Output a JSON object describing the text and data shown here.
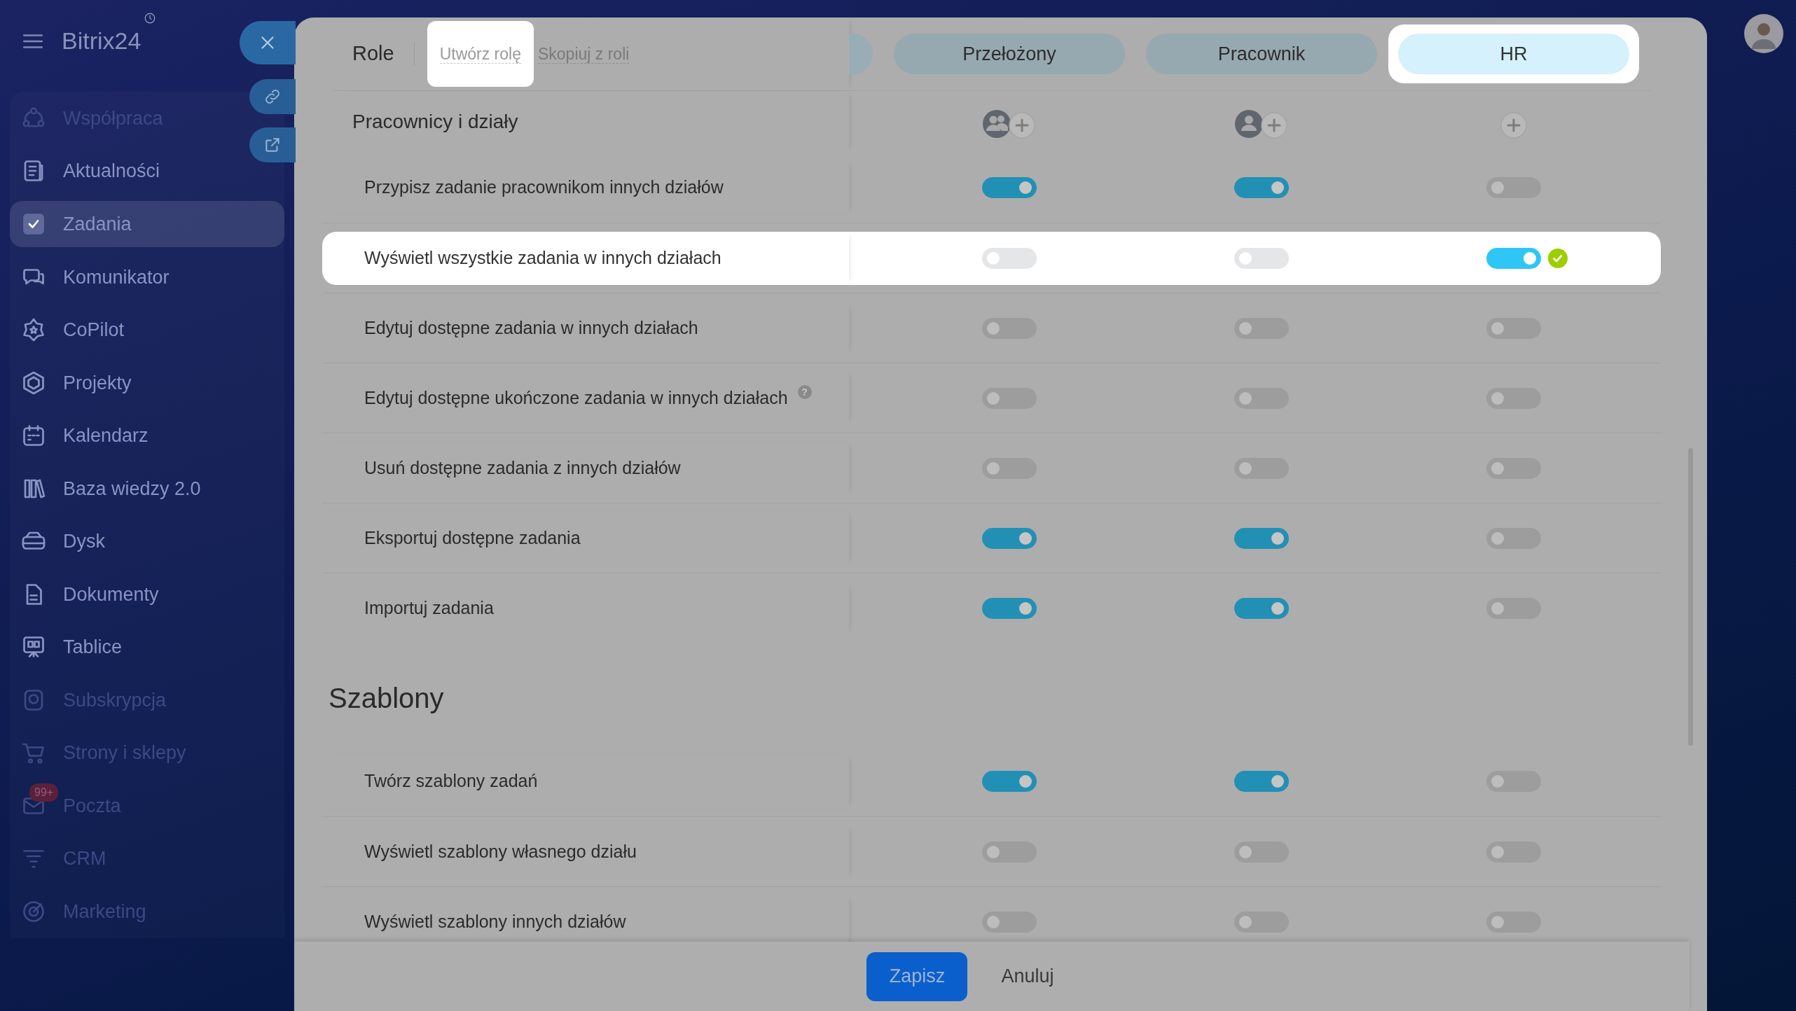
{
  "sidebar": {
    "logo": "Bitrix24",
    "items": [
      {
        "label": "Współpraca",
        "selected": false,
        "dimmed": true
      },
      {
        "label": "Aktualności",
        "selected": false,
        "dimmed": false
      },
      {
        "label": "Zadania",
        "selected": true,
        "dimmed": false
      },
      {
        "label": "Komunikator",
        "selected": false,
        "dimmed": false
      },
      {
        "label": "CoPilot",
        "selected": false,
        "dimmed": false
      },
      {
        "label": "Projekty",
        "selected": false,
        "dimmed": false
      },
      {
        "label": "Kalendarz",
        "selected": false,
        "dimmed": false
      },
      {
        "label": "Baza wiedzy 2.0",
        "selected": false,
        "dimmed": false
      },
      {
        "label": "Dysk",
        "selected": false,
        "dimmed": false
      },
      {
        "label": "Dokumenty",
        "selected": false,
        "dimmed": false
      },
      {
        "label": "Tablice",
        "selected": false,
        "dimmed": false
      },
      {
        "label": "Subskrypcja",
        "selected": false,
        "dimmed": true
      },
      {
        "label": "Strony i sklepy",
        "selected": false,
        "dimmed": true
      },
      {
        "label": "Poczta",
        "selected": false,
        "dimmed": true,
        "badge": "99+"
      },
      {
        "label": "CRM",
        "selected": false,
        "dimmed": true
      },
      {
        "label": "Marketing",
        "selected": false,
        "dimmed": true
      }
    ]
  },
  "header": {
    "title": "Role",
    "actions": [
      {
        "label": "Utwórz rolę",
        "highlighted": true
      },
      {
        "label": "Skopiuj z roli",
        "highlighted": false
      }
    ]
  },
  "roles": [
    {
      "label": "Przełożony",
      "highlighted": false,
      "members": {
        "kind": "group"
      }
    },
    {
      "label": "Pracownik",
      "highlighted": false,
      "members": {
        "kind": "single"
      }
    },
    {
      "label": "HR",
      "highlighted": true,
      "members": {
        "kind": "add_only"
      }
    }
  ],
  "sections": [
    {
      "title": "Pracownicy i działy",
      "kind": "row_heading",
      "rows": [
        {
          "label": "Przypisz zadanie pracownikom innych działów",
          "highlighted": false,
          "values": [
            {
              "on": true
            },
            {
              "on": true
            },
            {
              "on": false
            }
          ]
        },
        {
          "label": "Wyświetl wszystkie zadania w innych działach",
          "highlighted": true,
          "values": [
            {
              "on": false
            },
            {
              "on": false
            },
            {
              "on": true,
              "confirmed": true
            }
          ]
        },
        {
          "label": "Edytuj dostępne zadania w innych działach",
          "highlighted": false,
          "values": [
            {
              "on": false
            },
            {
              "on": false
            },
            {
              "on": false
            }
          ]
        },
        {
          "label": "Edytuj dostępne ukończone zadania w innych działach",
          "help": "?",
          "highlighted": false,
          "values": [
            {
              "on": false
            },
            {
              "on": false
            },
            {
              "on": false
            }
          ]
        },
        {
          "label": "Usuń dostępne zadania z innych działów",
          "highlighted": false,
          "values": [
            {
              "on": false
            },
            {
              "on": false
            },
            {
              "on": false
            }
          ]
        },
        {
          "label": "Eksportuj dostępne zadania",
          "highlighted": false,
          "values": [
            {
              "on": true
            },
            {
              "on": true
            },
            {
              "on": false
            }
          ]
        },
        {
          "label": "Importuj zadania",
          "highlighted": false,
          "values": [
            {
              "on": true
            },
            {
              "on": true
            },
            {
              "on": false
            }
          ]
        }
      ]
    },
    {
      "title": "Szablony",
      "kind": "page_heading",
      "rows": [
        {
          "label": "Twórz szablony zadań",
          "highlighted": false,
          "values": [
            {
              "on": true
            },
            {
              "on": true
            },
            {
              "on": false
            }
          ]
        },
        {
          "label": "Wyświetl szablony własnego działu",
          "highlighted": false,
          "values": [
            {
              "on": false
            },
            {
              "on": false
            },
            {
              "on": false
            }
          ]
        },
        {
          "label": "Wyświetl szablony innych działów",
          "highlighted": false,
          "values": [
            {
              "on": false
            },
            {
              "on": false
            },
            {
              "on": false
            }
          ]
        }
      ]
    }
  ],
  "footer": {
    "buttons": [
      {
        "label": "Zapisz",
        "kind": "primary"
      },
      {
        "label": "Anuluj",
        "kind": "link"
      }
    ]
  }
}
